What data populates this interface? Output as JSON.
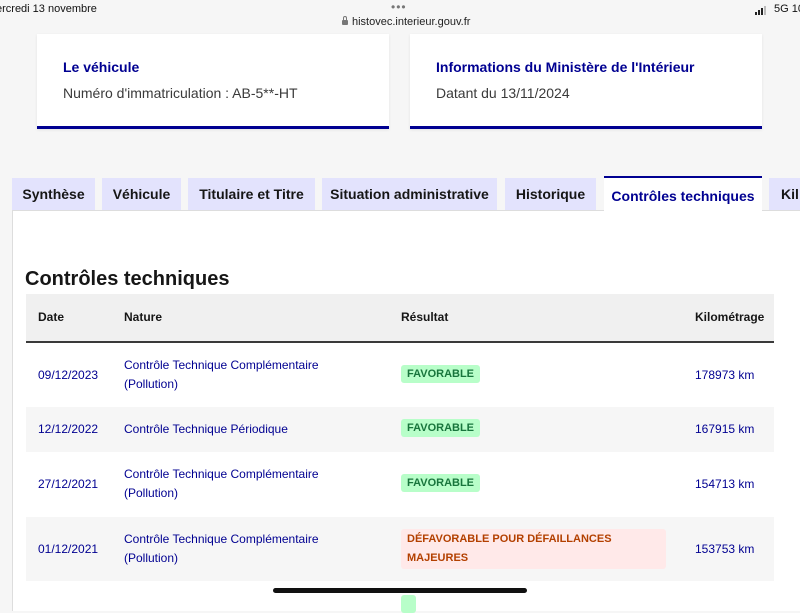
{
  "statusbar": {
    "date": "ercredi 13 novembre",
    "dots": "•••",
    "url": "histovec.interieur.gouv.fr",
    "network": "5G",
    "battery": "10"
  },
  "cards": [
    {
      "title": "Le véhicule",
      "text": "Numéro d'immatriculation : AB-5**-HT"
    },
    {
      "title": "Informations du Ministère de l'Intérieur",
      "text": "Datant du 13/11/2024"
    }
  ],
  "tabs": [
    {
      "label": "Synthèse",
      "active": false
    },
    {
      "label": "Véhicule",
      "active": false
    },
    {
      "label": "Titulaire et Titre",
      "active": false
    },
    {
      "label": "Situation administrative",
      "active": false
    },
    {
      "label": "Historique",
      "active": false
    },
    {
      "label": "Contrôles techniques",
      "active": true
    },
    {
      "label": "Kil",
      "active": false
    }
  ],
  "section_title": "Contrôles techniques",
  "table": {
    "headers": [
      "Date",
      "Nature",
      "Résultat",
      "Kilométrage"
    ],
    "rows": [
      {
        "date": "09/12/2023",
        "nature_line1": "Contrôle Technique Complémentaire",
        "nature_line2": "(Pollution)",
        "result_line1": "FAVORABLE",
        "result_line2": "",
        "km": "178973 km"
      },
      {
        "date": "12/12/2022",
        "nature_line1": "Contrôle Technique Périodique",
        "nature_line2": "",
        "result_line1": "FAVORABLE",
        "result_line2": "",
        "km": "167915 km"
      },
      {
        "date": "27/12/2021",
        "nature_line1": "Contrôle Technique Complémentaire",
        "nature_line2": "(Pollution)",
        "result_line1": "FAVORABLE",
        "result_line2": "",
        "km": "154713 km"
      },
      {
        "date": "01/12/2021",
        "nature_line1": "Contrôle Technique Complémentaire",
        "nature_line2": "(Pollution)",
        "result_line1": "DÉFAVORABLE POUR DÉFAILLANCES",
        "result_line2": "MAJEURES",
        "km": "153753 km"
      }
    ]
  },
  "colors": {
    "accent": "#000091",
    "tab_inactive": "#e3e3fd",
    "favorable_bg": "#b8fec9",
    "favorable_text": "#18753c",
    "defavorable_bg": "#ffe9e9",
    "defavorable_text": "#b34000"
  }
}
